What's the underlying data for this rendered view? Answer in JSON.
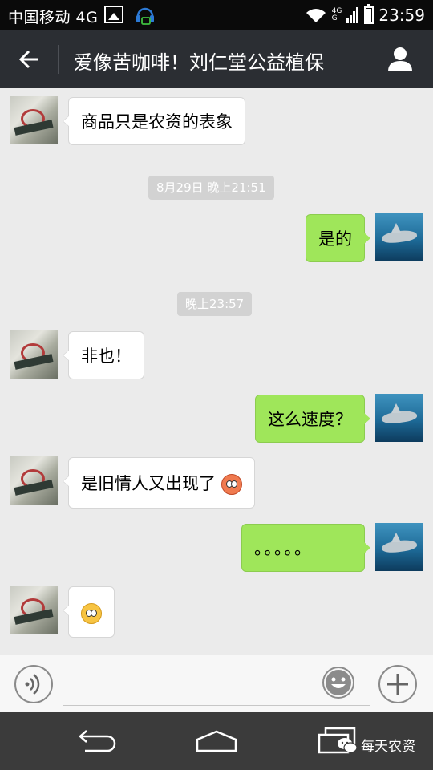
{
  "status_bar": {
    "carrier": "中国移动 4G",
    "network_top": "4G",
    "network_bottom": "G",
    "time": "23:59"
  },
  "title_bar": {
    "title": "爱像苦咖啡！刘仁堂公益植保"
  },
  "messages": [
    {
      "side": "in",
      "text": "商品只是农资的表象"
    },
    {
      "type": "timestamp",
      "text": "8月29日 晚上21:51"
    },
    {
      "side": "out",
      "text": "是的"
    },
    {
      "type": "timestamp",
      "text": "晚上23:57"
    },
    {
      "side": "in",
      "text": "非也！"
    },
    {
      "side": "out",
      "text": "这么速度？"
    },
    {
      "side": "in",
      "text": "是旧情人又出现了",
      "emoji": "flushed-face-icon"
    },
    {
      "side": "out",
      "text": "。。。。。"
    },
    {
      "side": "in",
      "text": "",
      "emoji": "rolling-eyes-face-icon"
    }
  ],
  "input_bar": {
    "placeholder": ""
  },
  "watermark": {
    "text": "每天农资"
  },
  "colors": {
    "status_bg": "#0a0a0a",
    "title_bg": "#2b2e33",
    "chat_bg": "#ebebeb",
    "incoming_bubble": "#ffffff",
    "outgoing_bubble": "#9fe65a",
    "timestamp_bg": "#d2d2d2",
    "nav_bg": "#3b3b3b"
  }
}
